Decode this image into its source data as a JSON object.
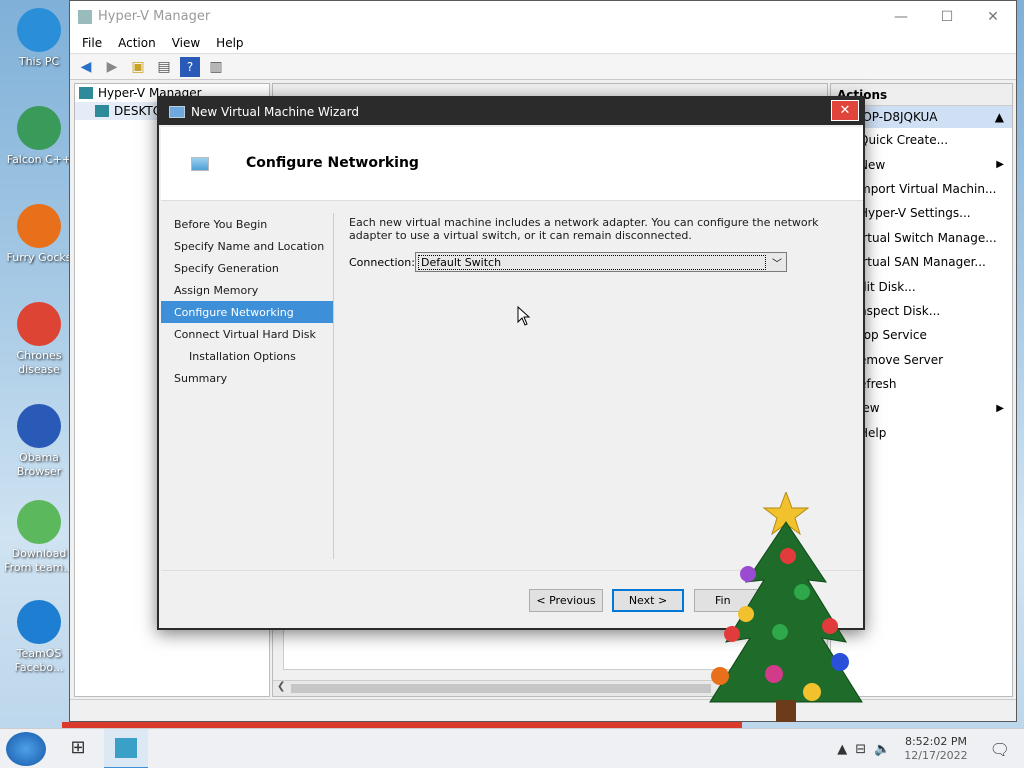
{
  "desktop": {
    "icons": [
      {
        "label": "This PC",
        "icon": "computer-icon",
        "color": "#2a8fd8"
      },
      {
        "label": "Falcon C++",
        "icon": "recycle-icon",
        "color": "#3a9a5a"
      },
      {
        "label": "Furry Gocks",
        "icon": "firefox-icon",
        "color": "#e8701a"
      },
      {
        "label": "Chrones disease",
        "icon": "chrome-icon",
        "color": "#dd4433"
      },
      {
        "label": "Obama Browser",
        "icon": "obama-logo-icon",
        "color": "#2a5ab8"
      },
      {
        "label": "Download From team...",
        "icon": "notepad-icon",
        "color": "#5cb85c"
      },
      {
        "label": "TeamOS Facebo...",
        "icon": "gear-icon",
        "color": "#1e7fd2"
      }
    ]
  },
  "hyperv": {
    "title": "Hyper-V Manager",
    "menu": [
      "File",
      "Action",
      "View",
      "Help"
    ],
    "tree": {
      "root": "Hyper-V Manager",
      "host": "DESKTO"
    },
    "actions": {
      "header": "Actions",
      "host": "TOP-D8JQKUA",
      "items": [
        {
          "label": "Quick Create...",
          "arrow": ""
        },
        {
          "label": "New",
          "arrow": "▶"
        },
        {
          "label": "mport Virtual Machin...",
          "arrow": ""
        },
        {
          "label": "Hyper-V Settings...",
          "arrow": ""
        },
        {
          "label": "irtual Switch Manage...",
          "arrow": ""
        },
        {
          "label": "irtual SAN Manager...",
          "arrow": ""
        },
        {
          "label": "dit Disk...",
          "arrow": ""
        },
        {
          "label": "nspect Disk...",
          "arrow": ""
        },
        {
          "label": "top Service",
          "arrow": ""
        },
        {
          "label": "emove Server",
          "arrow": ""
        },
        {
          "label": "efresh",
          "arrow": ""
        },
        {
          "label": "iew",
          "arrow": "▶"
        },
        {
          "label": "Help",
          "arrow": ""
        }
      ]
    }
  },
  "wizard": {
    "title": "New Virtual Machine Wizard",
    "close": "✕",
    "page_title": "Configure Networking",
    "nav": [
      {
        "label": "Before You Begin",
        "sub": false,
        "active": false
      },
      {
        "label": "Specify Name and Location",
        "sub": false,
        "active": false
      },
      {
        "label": "Specify Generation",
        "sub": false,
        "active": false
      },
      {
        "label": "Assign Memory",
        "sub": false,
        "active": false
      },
      {
        "label": "Configure Networking",
        "sub": false,
        "active": true
      },
      {
        "label": "Connect Virtual Hard Disk",
        "sub": false,
        "active": false
      },
      {
        "label": "Installation Options",
        "sub": true,
        "active": false
      },
      {
        "label": "Summary",
        "sub": false,
        "active": false
      }
    ],
    "description": "Each new virtual machine includes a network adapter. You can configure the network adapter to use a virtual switch, or it can remain disconnected.",
    "connection_label": "Connection:",
    "connection_value": "Default Switch",
    "buttons": {
      "previous": "< Previous",
      "next": "Next >",
      "finish": "Fin"
    }
  },
  "taskbar": {
    "time": "8:52:02 PM",
    "date": "12/17/2022"
  }
}
